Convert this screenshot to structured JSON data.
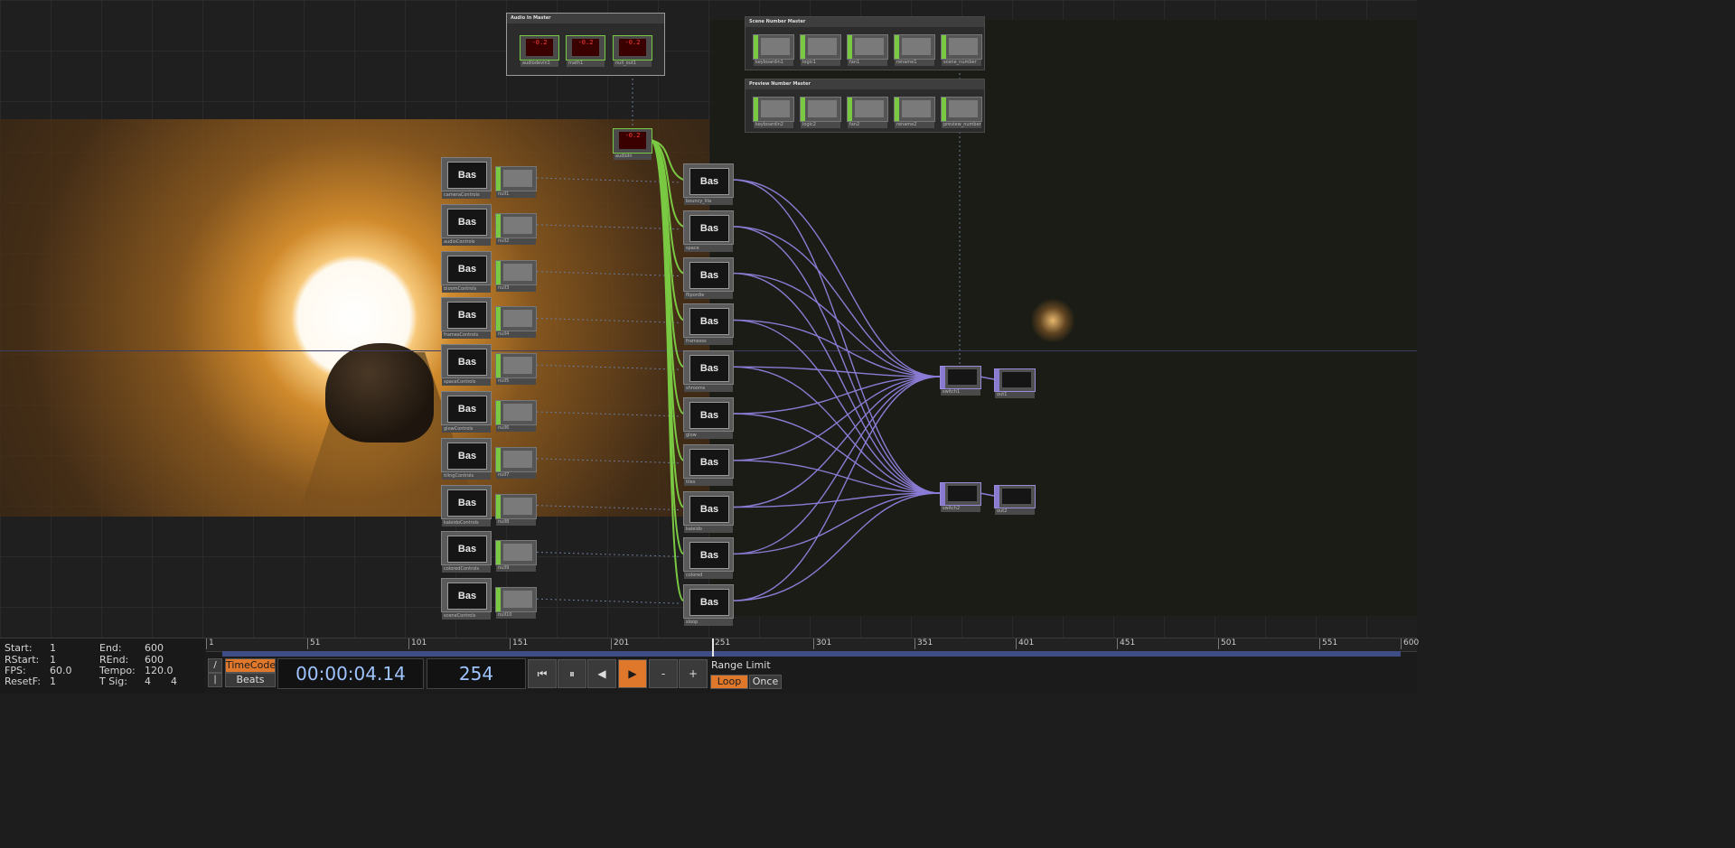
{
  "groups": {
    "audio_master": {
      "title": "Audio In Master",
      "nodes": [
        {
          "name": "audiodevin1",
          "readout": "-0.2"
        },
        {
          "name": "math1",
          "readout": "-0.2"
        },
        {
          "name": "null_out1",
          "readout": "-0.2"
        }
      ]
    },
    "scene_master": {
      "title": "Scene Number Master",
      "nodes": [
        "keyboardin1",
        "logic1",
        "fan1",
        "rename1",
        "scene_number"
      ]
    },
    "preview_master": {
      "title": "Preview Number Master",
      "nodes": [
        "keyboardin2",
        "logic2",
        "fan2",
        "rename2",
        "preview_number"
      ]
    }
  },
  "audio_out": {
    "name": "audioIn",
    "readout": "-0.2"
  },
  "controls": [
    {
      "bas": "cameraControls",
      "chop": "null1"
    },
    {
      "bas": "audioControls",
      "chop": "null2"
    },
    {
      "bas": "bloomControls",
      "chop": "null3"
    },
    {
      "bas": "framesControls",
      "chop": "null4"
    },
    {
      "bas": "spaceControls",
      "chop": "null5"
    },
    {
      "bas": "glowControls",
      "chop": "null6"
    },
    {
      "bas": "tilingControls",
      "chop": "null7"
    },
    {
      "bas": "kaleidoControls",
      "chop": "null8"
    },
    {
      "bas": "coloredControls",
      "chop": "null9"
    },
    {
      "bas": "sceneControls",
      "chop": "null10"
    }
  ],
  "scenes": [
    "bouncy_lila",
    "space",
    "flipordie",
    "framesss",
    "shrooms",
    "glow",
    "tiles",
    "kaleido",
    "colored",
    "sloop"
  ],
  "switches": [
    {
      "switch": "switch1",
      "out": "out1"
    },
    {
      "switch": "switch2",
      "out": "out2"
    }
  ],
  "bas_label": "Bas",
  "timeline": {
    "start_label": "Start:",
    "start": "1",
    "end_label": "End:",
    "end": "600",
    "rstart_label": "RStart:",
    "rstart": "1",
    "rend_label": "REnd:",
    "rend": "600",
    "fps_label": "FPS:",
    "fps": "60.0",
    "tempo_label": "Tempo:",
    "tempo": "120.0",
    "resetf_label": "ResetF:",
    "resetf": "1",
    "tsig_label": "T Sig:",
    "tsig_num": "4",
    "tsig_den": "4",
    "ticks": [
      "1",
      "51",
      "101",
      "151",
      "201",
      "251",
      "301",
      "351",
      "401",
      "451",
      "501",
      "551",
      "600"
    ],
    "timecode_label": "TimeCode",
    "beats_label": "Beats",
    "timecode": "00:00:04.14",
    "frame": "254",
    "range_limit_label": "Range Limit",
    "loop_label": "Loop",
    "once_label": "Once",
    "transport": {
      "rewind": "⏮",
      "pause": "⏸",
      "step_back": "◀",
      "play": "▶",
      "minus": "-",
      "plus": "+"
    }
  },
  "colors": {
    "accent": "#e0782c",
    "wire_green": "#7ac943",
    "wire_purple": "#8b7bd4",
    "wire_dotted": "#6a7a9a"
  }
}
